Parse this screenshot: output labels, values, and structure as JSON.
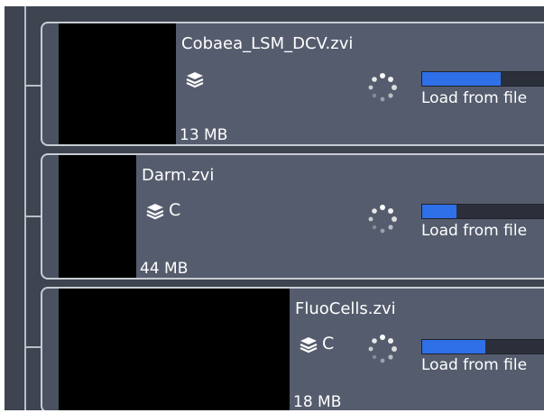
{
  "files": [
    {
      "name": "Cobaea_LSM_DCV.zvi",
      "channel": "",
      "size": "13 MB",
      "status": "Load from file",
      "progress": 0.62,
      "icons": [
        "z-stack-icon",
        "loading-spinner-icon"
      ]
    },
    {
      "name": "Darm.zvi",
      "channel": "C",
      "size": "44 MB",
      "status": "Load from file",
      "progress": 0.27,
      "icons": [
        "z-stack-icon",
        "loading-spinner-icon"
      ]
    },
    {
      "name": "FluoCells.zvi",
      "channel": "C",
      "size": "18 MB",
      "status": "Load from file",
      "progress": 0.5,
      "icons": [
        "z-stack-icon",
        "loading-spinner-icon"
      ]
    }
  ],
  "colors": {
    "panel": "#3e4450",
    "info": "#555c6d",
    "progress_fill": "#2f6fe8",
    "thumbnail": "#000000"
  }
}
